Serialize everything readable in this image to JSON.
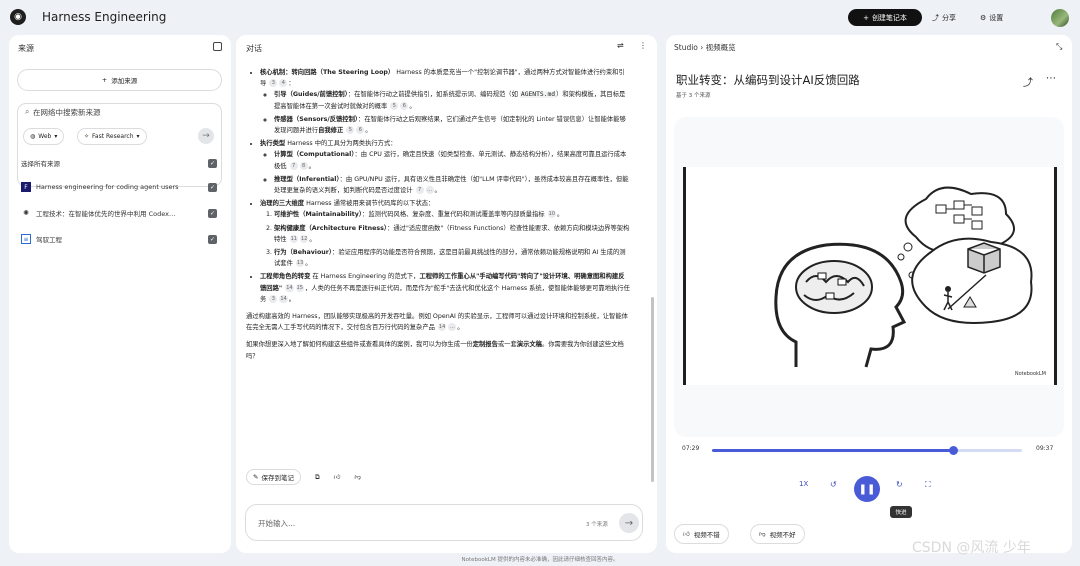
{
  "header": {
    "app_title": "Harness Engineering",
    "create_notebook": "创建笔记本",
    "share": "分享",
    "settings": "设置"
  },
  "sources_panel": {
    "title": "来源",
    "add_source": "添加来源",
    "search_placeholder": "在网络中搜索新来源",
    "web_chip": "Web",
    "research_chip": "Fast Research",
    "select_all": "选择所有来源",
    "items": [
      {
        "label": "Harness engineering for coding agent users",
        "icon": "document-icon"
      },
      {
        "label": "工程技术：在智能体优先的世界中利用 Codex…",
        "icon": "openai-icon"
      },
      {
        "label": "驾驭工程",
        "icon": "note-icon"
      }
    ]
  },
  "chat_panel": {
    "title": "对话",
    "b1_title": "核心机制：转向回路（The Steering Loop）",
    "b1_text": "Harness 的本质是充当一个\"控制论调节器\"，通过两种方式对智能体进行约束和引导",
    "b1_s1_title": "引导（Guides/前馈控制）",
    "b1_s1_text": "：在智能体行动之前提供指引，如系统提示词、编码规范（如",
    "b1_s1_code": "AGENTS.md",
    "b1_s1_text2": "）和架构模板，其目标是提高智能体在第一次尝试时就做对的概率",
    "b1_s2_title": "传感器（Sensors/反馈控制）",
    "b1_s2_text": "：在智能体行动之后观察结果，它们通过产生信号（如定制化的 Linter 错误信息）让智能体能够发现问题并进行",
    "b1_s2_bold": "自我修正",
    "b2_title": "执行类型",
    "b2_text": " Harness 中的工具分为两类执行方式：",
    "b2_s1_title": "计算型（Computational）",
    "b2_s1_text": "：由 CPU 运行，确定且快速（如类型检查、单元测试、静态结构分析），结果高度可靠且运行成本极低",
    "b2_s2_title": "推理型（Inferential）",
    "b2_s2_text": "：由 GPU/NPU 运行，具有语义性且非确定性（如\"LLM 评审代码\"），虽然成本较高且存在概率性，但能处理更复杂的语义判断，如判断代码是否过度设计",
    "b3_title": "治理的三大维度",
    "b3_text": " Harness 通常被用来调节代码库的以下状态：",
    "b3_s1_title": "可维护性（Maintainability）",
    "b3_s1_text": "：监测代码风格、复杂度、重复代码和测试覆盖率等内部质量指标",
    "b3_s2_title": "架构健康度（Architecture Fitness）",
    "b3_s2_text": "：通过\"适应度函数\"（Fitness Functions）检查性能要求、依赖方向和模块边界等架构特性",
    "b3_s3_title": "行为（Behaviour）",
    "b3_s3_text": "：验证应用程序的功能是否符合预期，这是目前最具挑战性的部分，通常依赖功能规格说明和 AI 生成的测试套件",
    "b4_title": "工程师角色的转变",
    "b4_text": " 在 Harness Engineering 的范式下，",
    "b4_bold": "工程师的工作重心从\"手动编写代码\"转向了\"设计环境、明确意图和构建反馈回路\"",
    "b4_text2": "，人类的任务不再是逐行纠正代码，而是作为\"舵手\"去迭代和优化这个 Harness 系统，使智能体能够更可靠地执行任务",
    "p1": "通过构建高效的 Harness，团队能够实现极高的开发吞吐量。例如 OpenAI 的实验显示，工程师可以通过设计环境和控制系统，让智能体在完全无需人工手写代码的情况下，交付包含百万行代码的复杂产品",
    "p2a": "如果你想更深入地了解如何构建这些组件或查看具体的案例，我可以为你生成一份",
    "p2_bold1": "定制报告",
    "p2b": "或一套",
    "p2_bold2": "演示文稿",
    "p2c": "。你需要我为你创建这些文档吗？",
    "save_note": "保存到笔记",
    "input_placeholder": "开始输入...",
    "source_count": "3 个来源"
  },
  "studio_panel": {
    "crumb_root": "Studio",
    "crumb_sep": "›",
    "crumb_current": "视频概览",
    "video_title": "职业转变：从编码到设计AI反馈回路",
    "video_sub": "基于 3 个来源",
    "watermark": "NotebookLM",
    "time_current": "07:29",
    "time_total": "09:37",
    "progress": 0.778,
    "speed": "1X",
    "tooltip": "快进",
    "good": "视频不错",
    "bad": "视频不好"
  },
  "footer": {
    "disclaimer": "NotebookLM 提供的内容未必准确，因此请仔细核查回答内容。",
    "watermark": "CSDN @风流 少年"
  },
  "colors": {
    "accent": "#4a5bd8",
    "background": "#eef1f6"
  }
}
